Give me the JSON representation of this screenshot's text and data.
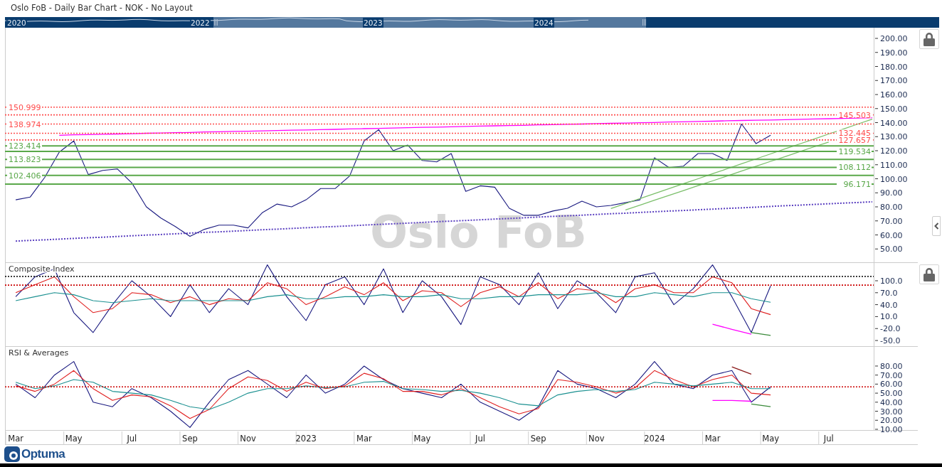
{
  "window": {
    "title": "Oslo FoB - Daily Bar Chart - NOK - No Layout"
  },
  "navigator": {
    "labels": [
      "2020",
      "2022",
      "2023",
      "2024"
    ]
  },
  "panels": [
    {
      "kind": "price",
      "watermark": "Oslo FoB",
      "chart_data": {
        "type": "line",
        "ylim": [
          40,
          207.6
        ],
        "yticks": [
          {
            "value": 200,
            "label": "200.00"
          },
          {
            "value": 190,
            "label": "190.00"
          },
          {
            "value": 180,
            "label": "180.00"
          },
          {
            "value": 170,
            "label": "170.00"
          },
          {
            "value": 160,
            "label": "160.00"
          },
          {
            "value": 150,
            "label": "150.00"
          },
          {
            "value": 140,
            "label": "140.00"
          },
          {
            "value": 130,
            "label": "130.00"
          },
          {
            "value": 120,
            "label": "120.00"
          },
          {
            "value": 110,
            "label": "110.00"
          },
          {
            "value": 100,
            "label": "100.00"
          },
          {
            "value": 90,
            "label": "90.00"
          },
          {
            "value": 80,
            "label": "80.00"
          },
          {
            "value": 70,
            "label": "70.00"
          },
          {
            "value": 60,
            "label": "60.00"
          },
          {
            "value": 50,
            "label": "50.00"
          }
        ],
        "categories": [
          null,
          null,
          null,
          null,
          null,
          null,
          null,
          null,
          null,
          null,
          null,
          null,
          null,
          null,
          null,
          null,
          null,
          null,
          null,
          null,
          null,
          null,
          null,
          null,
          null,
          null,
          null,
          null,
          null,
          null,
          null,
          null,
          null,
          null,
          null,
          null,
          null,
          null,
          null,
          null,
          null,
          null,
          null,
          null,
          null,
          null,
          null,
          null,
          null,
          null,
          null,
          null,
          null,
          null,
          null,
          null,
          null,
          null,
          null,
          null
        ],
        "series": [
          {
            "color": "#1a1a80",
            "values": [
              85,
              87,
              101,
              119,
              127,
              103,
              106,
              107,
              97,
              80,
              72,
              66,
              59,
              64,
              67,
              67,
              65,
              76,
              82,
              80,
              85,
              93,
              93,
              102,
              127,
              135,
              120,
              124,
              113,
              112,
              118,
              91,
              95,
              94,
              79,
              74,
              74,
              77,
              79,
              84,
              80,
              81,
              83,
              85,
              115,
              108,
              109,
              118,
              118,
              113,
              139,
              125,
              131,
              null,
              null,
              null,
              null,
              null,
              null,
              null
            ]
          },
          {
            "color": "#ff00ff",
            "values": [
              null,
              null,
              null,
              131.0,
              131.3,
              131.5,
              131.7,
              131.9,
              132.1,
              132.4,
              132.6,
              132.8,
              133.0,
              133.3,
              133.5,
              133.7,
              133.9,
              134.1,
              134.4,
              134.6,
              134.8,
              135.0,
              135.2,
              135.5,
              135.7,
              135.9,
              136.1,
              136.4,
              136.6,
              136.8,
              137.0,
              137.3,
              137.5,
              137.7,
              137.9,
              138.1,
              138.4,
              138.6,
              138.8,
              139.0,
              139.3,
              139.5,
              139.7,
              139.9,
              140.1,
              140.4,
              140.6,
              140.8,
              141.0,
              141.3,
              141.5,
              141.7,
              141.9,
              142.1,
              142.4,
              142.6,
              142.8,
              143.0,
              143.3,
              143.5
            ]
          },
          {
            "color": "#5a3fc0",
            "line_style": "dotted",
            "values": [
              55.6,
              56.1,
              56.5,
              57.0,
              57.5,
              58.0,
              58.4,
              58.9,
              59.4,
              59.9,
              60.3,
              60.8,
              61.3,
              61.8,
              62.2,
              62.7,
              63.2,
              63.7,
              64.1,
              64.6,
              65.1,
              65.6,
              66.0,
              66.5,
              67.0,
              67.5,
              67.9,
              68.4,
              68.9,
              69.4,
              69.8,
              70.3,
              70.8,
              71.3,
              71.7,
              72.2,
              72.7,
              73.2,
              73.6,
              74.1,
              74.6,
              75.1,
              75.5,
              76.0,
              76.5,
              77.0,
              77.4,
              77.9,
              78.4,
              78.9,
              79.3,
              79.8,
              80.3,
              80.8,
              81.2,
              81.7,
              82.2,
              82.7,
              83.1,
              83.6
            ]
          },
          {
            "color": "#7bbf6a",
            "values": [
              null,
              null,
              null,
              null,
              null,
              null,
              null,
              null,
              null,
              null,
              null,
              null,
              null,
              null,
              null,
              null,
              null,
              null,
              null,
              null,
              null,
              null,
              null,
              null,
              null,
              null,
              null,
              null,
              null,
              null,
              null,
              null,
              null,
              null,
              null,
              null,
              null,
              null,
              null,
              null,
              null,
              78.8,
              82.4,
              85.9,
              89.4,
              93.0,
              96.5,
              100.0,
              103.6,
              107.1,
              110.7,
              114.2,
              117.7,
              121.3,
              124.8,
              128.3,
              131.9,
              135.4,
              139.0,
              142.5
            ]
          },
          {
            "color": "#7bbf6b",
            "values": [
              null,
              null,
              null,
              null,
              null,
              null,
              null,
              null,
              null,
              null,
              null,
              null,
              null,
              null,
              null,
              null,
              null,
              null,
              null,
              null,
              null,
              null,
              null,
              null,
              null,
              null,
              null,
              null,
              null,
              null,
              null,
              null,
              null,
              null,
              null,
              null,
              null,
              null,
              null,
              null,
              null,
              null,
              77.8,
              81.2,
              84.7,
              88.2,
              91.6,
              95.1,
              98.5,
              102.0,
              105.5,
              108.9,
              112.4,
              115.8,
              119.3,
              122.8,
              126.2,
              null,
              null,
              null
            ]
          }
        ],
        "ref_lines": [
          {
            "axis": "y",
            "value": 150.999,
            "label": "150.999",
            "color": "#ff4d4d"
          },
          {
            "axis": "y",
            "value": 145.503,
            "label": "145.503",
            "color": "#ff4d4d"
          },
          {
            "axis": "y",
            "value": 138.974,
            "label": "138.974",
            "color": "#ff4d4d"
          },
          {
            "axis": "y",
            "value": 132.445,
            "label": "132.445",
            "color": "#ff4d4d"
          },
          {
            "axis": "y",
            "value": 127.657,
            "label": "127.657",
            "color": "#ff4d4d"
          },
          {
            "axis": "y",
            "value": 123.414,
            "label": "123.414",
            "color": "#5aa84a"
          },
          {
            "axis": "y",
            "value": 119.534,
            "label": "119.534",
            "color": "#5aa84a"
          },
          {
            "axis": "y",
            "value": 113.823,
            "label": "113.823",
            "color": "#5aa84a"
          },
          {
            "axis": "y",
            "value": 108.112,
            "label": "108.112",
            "color": "#5aa84a"
          },
          {
            "axis": "y",
            "value": 102.406,
            "label": "102.406",
            "color": "#5aa84a"
          },
          {
            "axis": "y",
            "value": 96.171,
            "label": "96.171",
            "color": "#5aa84a"
          }
        ]
      }
    },
    {
      "kind": "indicator",
      "chart_data": {
        "type": "line",
        "title": "Composite Index",
        "ylim": [
          -66,
          144.6
        ],
        "yticks": [
          {
            "value": 100,
            "label": "100.0"
          },
          {
            "value": 70,
            "label": "70.0"
          },
          {
            "value": 40,
            "label": "40.0"
          },
          {
            "value": 10,
            "label": "10.0"
          },
          {
            "value": -20,
            "label": "-20.0"
          },
          {
            "value": -50,
            "label": "-50.0"
          }
        ],
        "categories": [
          null,
          null,
          null,
          null,
          null,
          null,
          null,
          null,
          null,
          null,
          null,
          null,
          null,
          null,
          null,
          null,
          null,
          null,
          null,
          null,
          null,
          null,
          null,
          null,
          null,
          null,
          null,
          null,
          null,
          null,
          null,
          null,
          null,
          null,
          null,
          null,
          null,
          null,
          null,
          null,
          null,
          null,
          null,
          null,
          null
        ],
        "series": [
          {
            "color": "#1a1a80",
            "values": [
              60,
              110,
              130,
              20,
              -30,
              40,
              100,
              60,
              10,
              90,
              20,
              80,
              40,
              140,
              60,
              0,
              90,
              110,
              40,
              130,
              20,
              100,
              60,
              -10,
              110,
              90,
              40,
              120,
              30,
              100,
              70,
              20,
              110,
              120,
              40,
              80,
              140,
              60,
              -30,
              87,
              null,
              null,
              null,
              null,
              null
            ]
          },
          {
            "color": "#e02020",
            "values": [
              70,
              90,
              110,
              60,
              20,
              30,
              70,
              65,
              45,
              60,
              40,
              55,
              50,
              95,
              80,
              40,
              60,
              85,
              65,
              95,
              50,
              75,
              70,
              35,
              70,
              85,
              60,
              95,
              55,
              80,
              75,
              45,
              80,
              90,
              70,
              70,
              110,
              95,
              30,
              15,
              null,
              null,
              null,
              null,
              null
            ]
          },
          {
            "color": "#1a9090",
            "values": [
              50,
              60,
              70,
              65,
              50,
              45,
              50,
              55,
              50,
              50,
              50,
              50,
              50,
              60,
              65,
              55,
              55,
              60,
              60,
              65,
              60,
              60,
              65,
              55,
              55,
              60,
              60,
              65,
              65,
              65,
              70,
              60,
              60,
              70,
              65,
              60,
              70,
              70,
              55,
              46,
              null,
              null,
              null,
              null,
              null
            ]
          },
          {
            "color": "#ff00ff",
            "values": [
              null,
              null,
              null,
              null,
              null,
              null,
              null,
              null,
              null,
              null,
              null,
              null,
              null,
              null,
              null,
              null,
              null,
              null,
              null,
              null,
              null,
              null,
              null,
              null,
              null,
              null,
              null,
              null,
              null,
              null,
              null,
              null,
              null,
              null,
              null,
              null,
              -9,
              -22,
              -34,
              null,
              null,
              null,
              null,
              null,
              null
            ]
          },
          {
            "color": "#3a8a3a",
            "values": [
              null,
              null,
              null,
              null,
              null,
              null,
              null,
              null,
              null,
              null,
              null,
              null,
              null,
              null,
              null,
              null,
              null,
              null,
              null,
              null,
              null,
              null,
              null,
              null,
              null,
              null,
              null,
              null,
              null,
              null,
              null,
              null,
              null,
              null,
              null,
              null,
              null,
              null,
              -30,
              -37,
              null,
              null,
              null,
              null,
              null
            ]
          }
        ],
        "ref_lines": [
          {
            "axis": "y",
            "value": 111,
            "color": "#222222"
          },
          {
            "axis": "y",
            "value": 89,
            "color": "#cc0000"
          }
        ]
      }
    },
    {
      "kind": "indicator",
      "chart_data": {
        "type": "line",
        "title": "RSI & Averages",
        "ylim": [
          8.4,
          101.2
        ],
        "yticks": [
          {
            "value": 80,
            "label": "80.00"
          },
          {
            "value": 70,
            "label": "70.00"
          },
          {
            "value": 60,
            "label": "60.00"
          },
          {
            "value": 50,
            "label": "50.00"
          },
          {
            "value": 40,
            "label": "40.00"
          },
          {
            "value": 30,
            "label": "30.00"
          },
          {
            "value": 20,
            "label": "20.00"
          },
          {
            "value": 10,
            "label": "10.00"
          }
        ],
        "categories": [
          "Mar",
          null,
          null,
          "May",
          null,
          null,
          "Jul",
          null,
          null,
          "Sep",
          null,
          null,
          "Nov",
          null,
          null,
          "2023",
          null,
          null,
          "Mar",
          null,
          null,
          "May",
          null,
          null,
          "Jul",
          null,
          null,
          "Sep",
          null,
          null,
          "Nov",
          null,
          null,
          "2024",
          null,
          null,
          "Mar",
          null,
          null,
          "May",
          null,
          null,
          "Jul",
          null,
          null
        ],
        "series": [
          {
            "color": "#1a1a80",
            "values": [
              60,
              45,
              70,
              85,
              40,
              35,
              55,
              45,
              30,
              12,
              40,
              65,
              75,
              60,
              45,
              70,
              50,
              60,
              80,
              65,
              55,
              50,
              45,
              60,
              40,
              30,
              20,
              35,
              75,
              60,
              55,
              45,
              60,
              85,
              60,
              55,
              70,
              75,
              40,
              57,
              null,
              null,
              null,
              null,
              null
            ]
          },
          {
            "color": "#e02020",
            "values": [
              58,
              52,
              60,
              75,
              55,
              42,
              48,
              46,
              36,
              22,
              32,
              55,
              68,
              64,
              52,
              62,
              55,
              58,
              72,
              66,
              52,
              52,
              48,
              55,
              45,
              35,
              27,
              33,
              65,
              62,
              57,
              50,
              56,
              75,
              65,
              57,
              65,
              70,
              50,
              48,
              null,
              null,
              null,
              null,
              null
            ]
          },
          {
            "color": "#1a9090",
            "values": [
              62,
              55,
              58,
              65,
              62,
              52,
              50,
              48,
              42,
              35,
              32,
              40,
              50,
              55,
              55,
              58,
              56,
              57,
              62,
              63,
              55,
              54,
              52,
              53,
              50,
              45,
              38,
              36,
              48,
              52,
              54,
              52,
              54,
              62,
              60,
              58,
              60,
              62,
              55,
              55,
              null,
              null,
              null,
              null,
              null
            ]
          },
          {
            "color": "#8b1a1a",
            "values": [
              null,
              null,
              null,
              null,
              null,
              null,
              null,
              null,
              null,
              null,
              null,
              null,
              null,
              null,
              null,
              null,
              null,
              null,
              null,
              null,
              null,
              null,
              null,
              null,
              null,
              null,
              null,
              null,
              null,
              null,
              null,
              null,
              null,
              null,
              null,
              null,
              null,
              79,
              71,
              null,
              null,
              null,
              null,
              null,
              null
            ]
          },
          {
            "color": "#ff00ff",
            "values": [
              null,
              null,
              null,
              null,
              null,
              null,
              null,
              null,
              null,
              null,
              null,
              null,
              null,
              null,
              null,
              null,
              null,
              null,
              null,
              null,
              null,
              null,
              null,
              null,
              null,
              null,
              null,
              null,
              null,
              null,
              null,
              null,
              null,
              null,
              null,
              null,
              42,
              42,
              41,
              null,
              null,
              null,
              null,
              null,
              null
            ]
          },
          {
            "color": "#3a8a3a",
            "values": [
              null,
              null,
              null,
              null,
              null,
              null,
              null,
              null,
              null,
              null,
              null,
              null,
              null,
              null,
              null,
              null,
              null,
              null,
              null,
              null,
              null,
              null,
              null,
              null,
              null,
              null,
              null,
              null,
              null,
              null,
              null,
              null,
              null,
              null,
              null,
              null,
              null,
              null,
              38,
              35,
              null,
              null,
              null,
              null,
              null
            ]
          }
        ],
        "ref_lines": [
          {
            "axis": "y",
            "value": 57,
            "color": "#cc0000"
          }
        ]
      }
    }
  ],
  "logo": {
    "text": "Optuma"
  }
}
